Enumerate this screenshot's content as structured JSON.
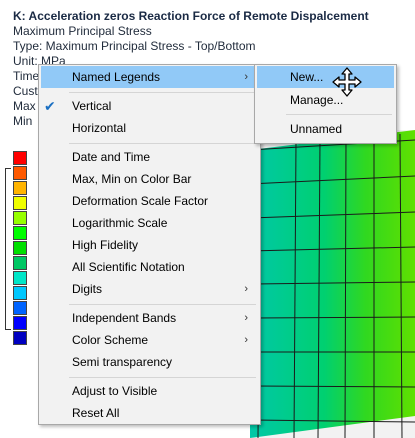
{
  "header": {
    "title": "K: Acceleration zeros Reaction Force of Remote Dispalcement",
    "lines": [
      "Maximum Principal Stress",
      "Type: Maximum Principal Stress - Top/Bottom",
      "Unit: MPa",
      "Time",
      "Cust",
      "Max",
      "Min"
    ]
  },
  "legend": {
    "colors": [
      "#ff0000",
      "#ff5a00",
      "#ffb400",
      "#f0ff00",
      "#96ff00",
      "#00ff00",
      "#00e000",
      "#00c864",
      "#00e6c8",
      "#00c8ff",
      "#0064ff",
      "#0000ff",
      "#0000c0"
    ]
  },
  "context_menu": {
    "items": [
      {
        "label": "Named Legends",
        "submenu": true,
        "highlighted": true
      },
      {
        "label": "Vertical",
        "checked": true
      },
      {
        "label": "Horizontal"
      },
      {
        "label": "Date and Time"
      },
      {
        "label": "Max, Min on Color Bar"
      },
      {
        "label": "Deformation Scale Factor"
      },
      {
        "label": "Logarithmic Scale"
      },
      {
        "label": "High Fidelity"
      },
      {
        "label": "All Scientific Notation"
      },
      {
        "label": "Digits",
        "submenu": true
      },
      {
        "label": "Independent Bands",
        "submenu": true
      },
      {
        "label": "Color Scheme",
        "submenu": true
      },
      {
        "label": "Semi transparency"
      },
      {
        "label": "Adjust to Visible"
      },
      {
        "label": "Reset All"
      }
    ],
    "arrow_glyph": "›",
    "check_glyph": "✔"
  },
  "submenu": {
    "items": [
      {
        "label": "New...",
        "highlighted": true
      },
      {
        "label": "Manage..."
      },
      {
        "label": "Unnamed"
      }
    ]
  }
}
